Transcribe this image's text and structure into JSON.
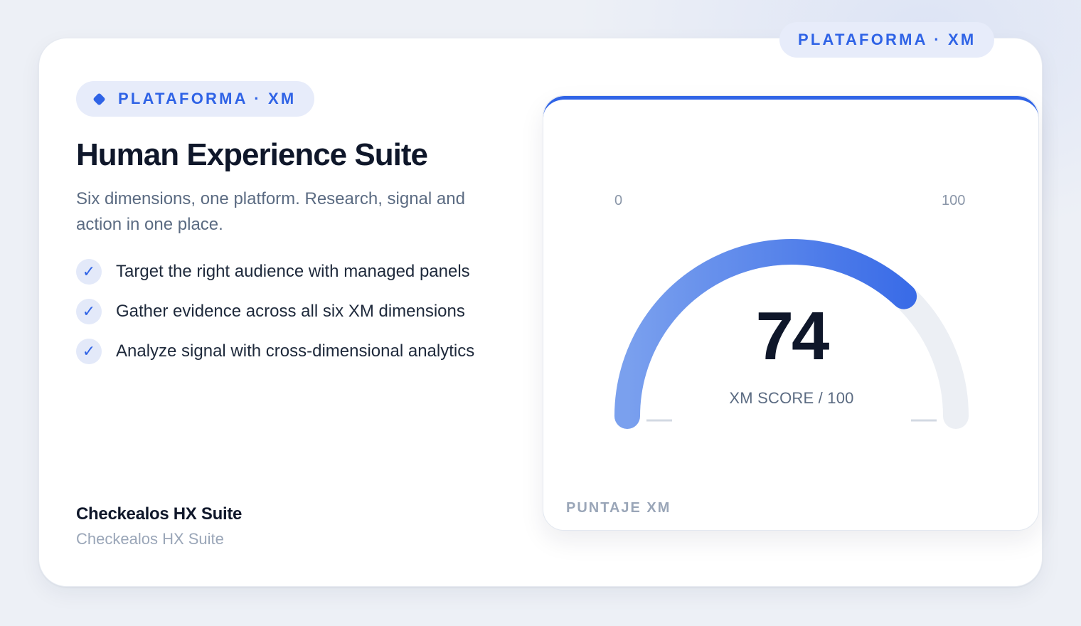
{
  "card": {
    "badge": "PLATAFORMA · XM",
    "title": "Human Experience Suite",
    "subtitle": "Six dimensions, one platform. Research, signal and action in one place.",
    "features": [
      "Target the right audience with managed panels",
      "Gather evidence across all six XM dimensions",
      "Analyze signal with cross-dimensional analytics"
    ],
    "brand_name": "Checkealos HX Suite",
    "brand_sub": "Checkealos HX Suite"
  },
  "panel": {
    "badge": "PLATAFORMA · XM",
    "min_label": "0",
    "max_label": "100",
    "score": "74",
    "score_label": "XM SCORE / 100",
    "footer": "PUNTAJE XM",
    "gauge": {
      "value": 74,
      "min": 0,
      "max": 100
    }
  },
  "colors": {
    "accent": "#2f63e6",
    "accent_light": "#7aa0ee",
    "track": "#eceff4",
    "text_dark": "#0f172a",
    "text_muted": "#5b6b82"
  },
  "icons": {
    "badge": "diamond-icon",
    "feature": "check-icon"
  }
}
